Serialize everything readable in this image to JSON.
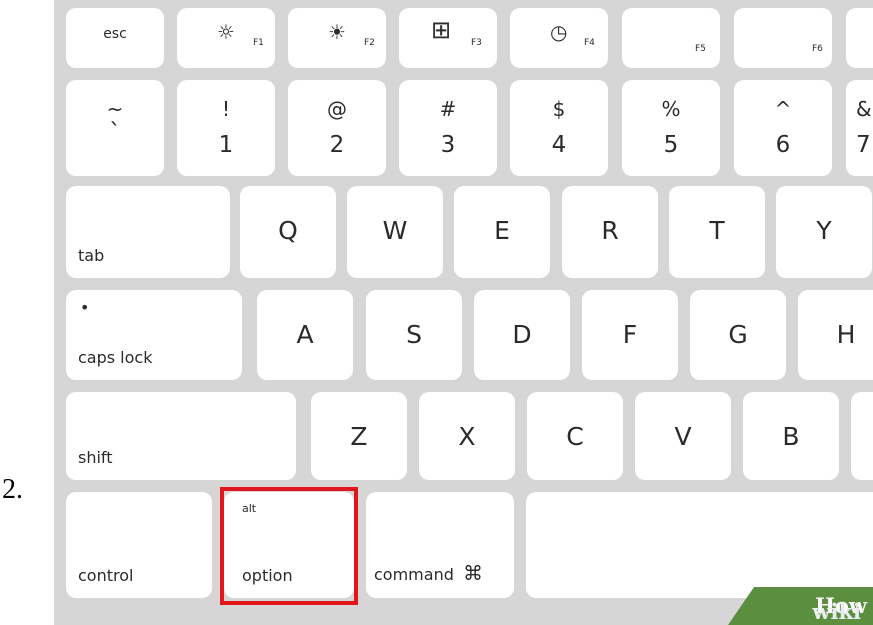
{
  "list_number": "2.",
  "fn_row": {
    "esc": "esc",
    "f1": {
      "symbol": "☼",
      "label": "F1"
    },
    "f2": {
      "symbol": "☀",
      "label": "F2"
    },
    "f3": {
      "symbol": "⊞",
      "label": "F3"
    },
    "f4": {
      "symbol": "◷",
      "label": "F4"
    },
    "f5": {
      "label": "F5"
    },
    "f6": {
      "label": "F6"
    }
  },
  "number_row": [
    {
      "top": "~",
      "bottom": "`"
    },
    {
      "top": "!",
      "bottom": "1"
    },
    {
      "top": "@",
      "bottom": "2"
    },
    {
      "top": "#",
      "bottom": "3"
    },
    {
      "top": "$",
      "bottom": "4"
    },
    {
      "top": "%",
      "bottom": "5"
    },
    {
      "top": "^",
      "bottom": "6"
    },
    {
      "top": "&",
      "bottom": "7"
    }
  ],
  "qwerty_row": {
    "tab": "tab",
    "keys": [
      "Q",
      "W",
      "E",
      "R",
      "T",
      "Y"
    ]
  },
  "home_row": {
    "caps_dot": "•",
    "caps_lock": "caps lock",
    "keys": [
      "A",
      "S",
      "D",
      "F",
      "G",
      "H"
    ]
  },
  "shift_row": {
    "shift": "shift",
    "keys": [
      "Z",
      "X",
      "C",
      "V",
      "B"
    ]
  },
  "bottom_row": {
    "control": "control",
    "option_top": "alt",
    "option": "option",
    "command": "command",
    "command_symbol": "⌘"
  },
  "watermark": {
    "part1": "wiki",
    "part2": "How"
  },
  "colors": {
    "highlight": "#e0161b",
    "keyboard_bg": "#d6d6d6",
    "watermark_bg": "#5b8e3e"
  }
}
